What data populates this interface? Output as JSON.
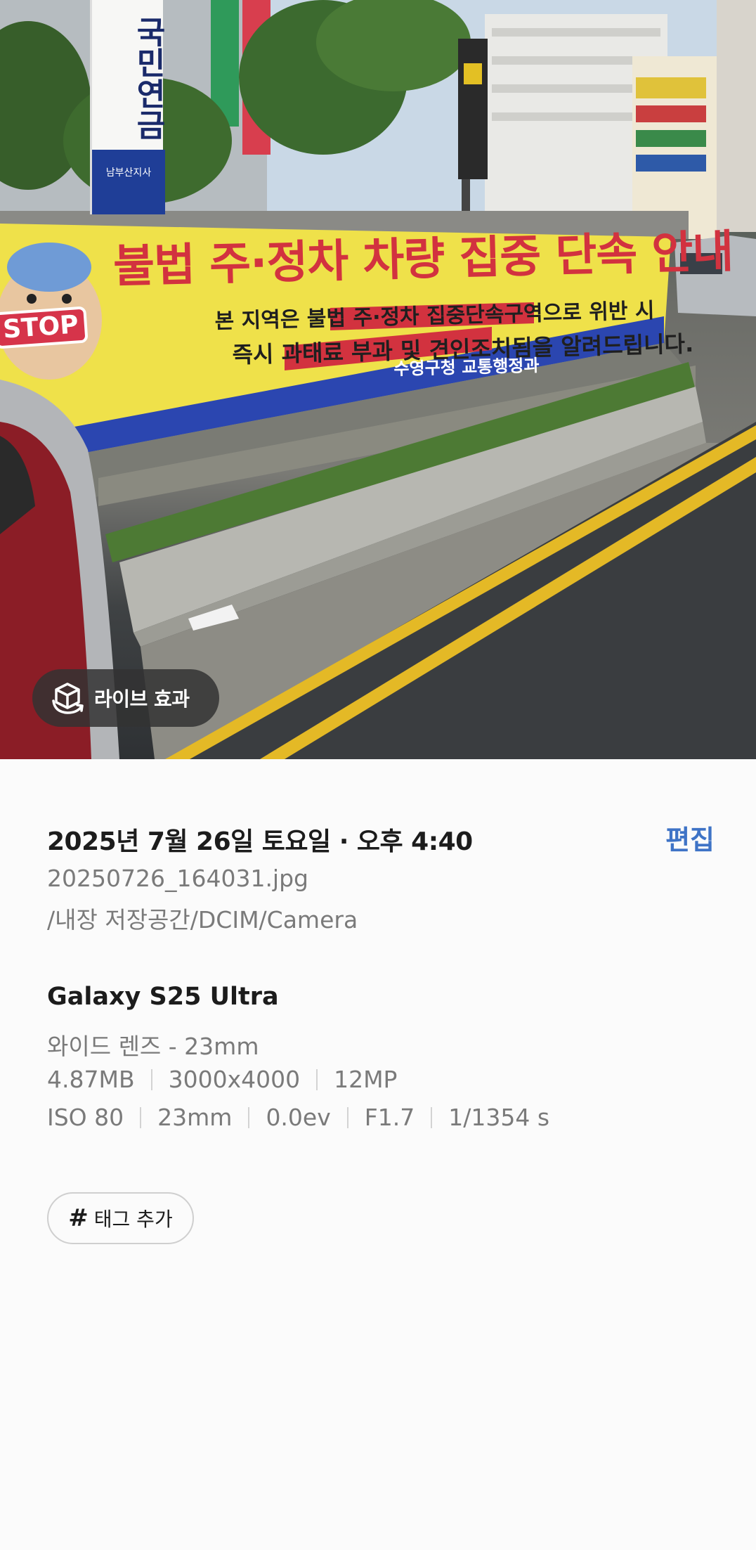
{
  "photo": {
    "banner": {
      "title": "불법 주·정차 차량 집중 단속 안내",
      "line2": "본 지역은 불법 주·정차 집중단속구역으로 위반 시",
      "line3": "즉시 과태료 부과 및 견인조치됨을 알려드립니다.",
      "org": "수영구청 교통행정과",
      "stop_text": "STOP"
    },
    "vertical_sign": {
      "text": "국민연금",
      "sub": "남부산지사"
    },
    "live_effect_button": {
      "label": "라이브 효과",
      "icon": "cube-rotate-icon"
    }
  },
  "details": {
    "datetime": "2025년 7월 26일 토요일 · 오후 4:40",
    "edit_label": "편집",
    "filename": "20250726_164031.jpg",
    "path": "/내장 저장공간/DCIM/Camera",
    "device": "Galaxy S25 Ultra",
    "lens": "와이드 렌즈 - 23mm",
    "file_specs": [
      "4.87MB",
      "3000x4000",
      "12MP"
    ],
    "camera_specs": [
      "ISO 80",
      "23mm",
      "0.0ev",
      "F1.7",
      "1/1354 s"
    ],
    "tag_button": {
      "hash": "#",
      "label": "태그 추가"
    }
  },
  "colors": {
    "accent": "#3e73c6",
    "banner_yellow": "#efe14a",
    "banner_blue": "#2b46b0",
    "banner_red": "#d2323f"
  }
}
